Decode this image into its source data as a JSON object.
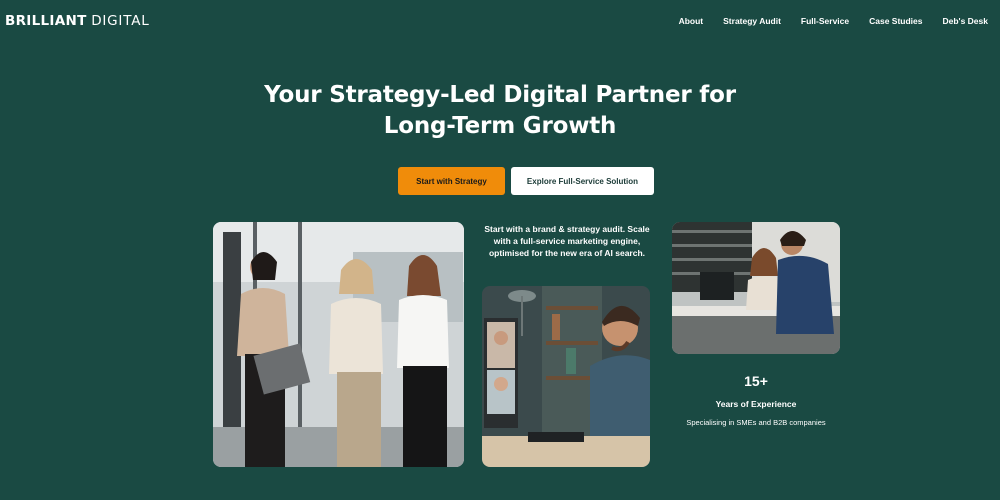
{
  "brand": {
    "logo_bold": "BRILLIANT",
    "logo_light": "DIGITAL"
  },
  "nav": {
    "items": [
      {
        "label": "About"
      },
      {
        "label": "Strategy Audit"
      },
      {
        "label": "Full-Service"
      },
      {
        "label": "Case Studies"
      },
      {
        "label": "Deb's Desk"
      }
    ]
  },
  "hero": {
    "title_line1": "Your Strategy-Led Digital Partner for",
    "title_line2": "Long-Term Growth",
    "primary_cta": "Start with Strategy",
    "secondary_cta": "Explore Full-Service Solution",
    "intro": "Start with a brand & strategy audit. Scale with a full-service marketing engine, optimised for the new era of AI search."
  },
  "stats": {
    "value": "15+",
    "label": "Years of Experience",
    "sub": "Specialising in SMEs and B2B companies"
  },
  "colors": {
    "background": "#1a4a43",
    "accent": "#f08c0a",
    "text": "#ffffff"
  },
  "icons": [
    "team-walking-photo",
    "video-call-photo",
    "office-meeting-photo"
  ]
}
